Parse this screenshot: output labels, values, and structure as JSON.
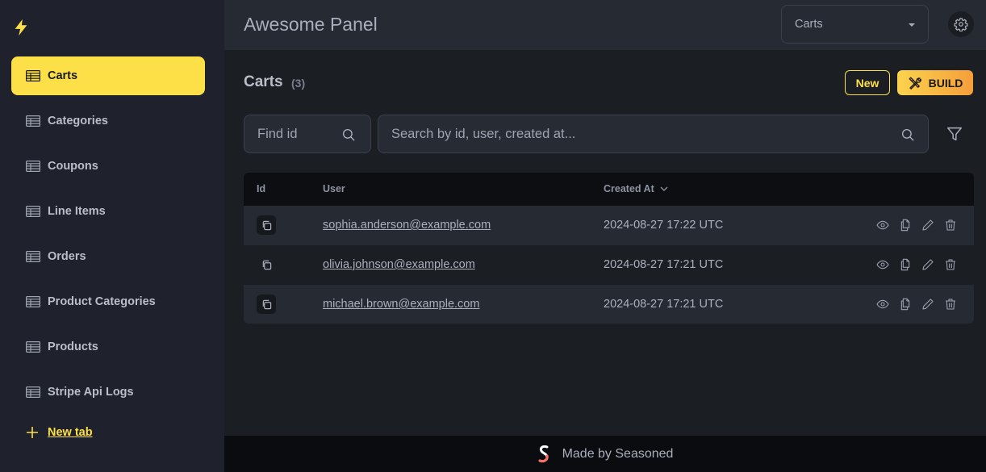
{
  "app": {
    "title": "Awesome Panel",
    "logo_icon": "lightning-bolt-icon"
  },
  "header": {
    "table_select": {
      "value": "Carts",
      "icon": "caret-down-icon"
    },
    "settings_icon": "gear-icon"
  },
  "sidebar": {
    "items": [
      {
        "label": "Carts",
        "active": true,
        "icon": "table-icon"
      },
      {
        "label": "Categories",
        "active": false,
        "icon": "table-icon"
      },
      {
        "label": "Coupons",
        "active": false,
        "icon": "table-icon"
      },
      {
        "label": "Line Items",
        "active": false,
        "icon": "table-icon"
      },
      {
        "label": "Orders",
        "active": false,
        "icon": "table-icon"
      },
      {
        "label": "Product Categories",
        "active": false,
        "icon": "table-icon"
      },
      {
        "label": "Products",
        "active": false,
        "icon": "table-icon"
      },
      {
        "label": "Stripe Api Logs",
        "active": false,
        "icon": "table-icon"
      }
    ],
    "new_tab_label": "New tab"
  },
  "main": {
    "title": "Carts",
    "count": "(3)",
    "new_label": "New",
    "build_label": "BUILD",
    "find_id_placeholder": "Find id",
    "search_placeholder": "Search by id, user, created at...",
    "table": {
      "headers": {
        "id": "Id",
        "user": "User",
        "created_at": "Created At"
      },
      "sort": {
        "column": "created_at",
        "direction": "desc"
      },
      "rows": [
        {
          "user": "sophia.anderson@example.com",
          "created_at": "2024-08-27 17:22 UTC"
        },
        {
          "user": "olivia.johnson@example.com",
          "created_at": "2024-08-27 17:21 UTC"
        },
        {
          "user": "michael.brown@example.com",
          "created_at": "2024-08-27 17:21 UTC"
        }
      ],
      "row_actions": [
        "view",
        "duplicate",
        "edit",
        "delete"
      ]
    }
  },
  "footer": {
    "text": "Made by Seasoned"
  },
  "colors": {
    "accent": "#fde047",
    "build_gradient_start": "#fcd34d",
    "build_gradient_end": "#f59e3b",
    "sidebar_bg": "#1f222c",
    "header_bg": "#252a33",
    "main_bg": "#1b1f24",
    "footer_bg": "#0b0c0f"
  }
}
